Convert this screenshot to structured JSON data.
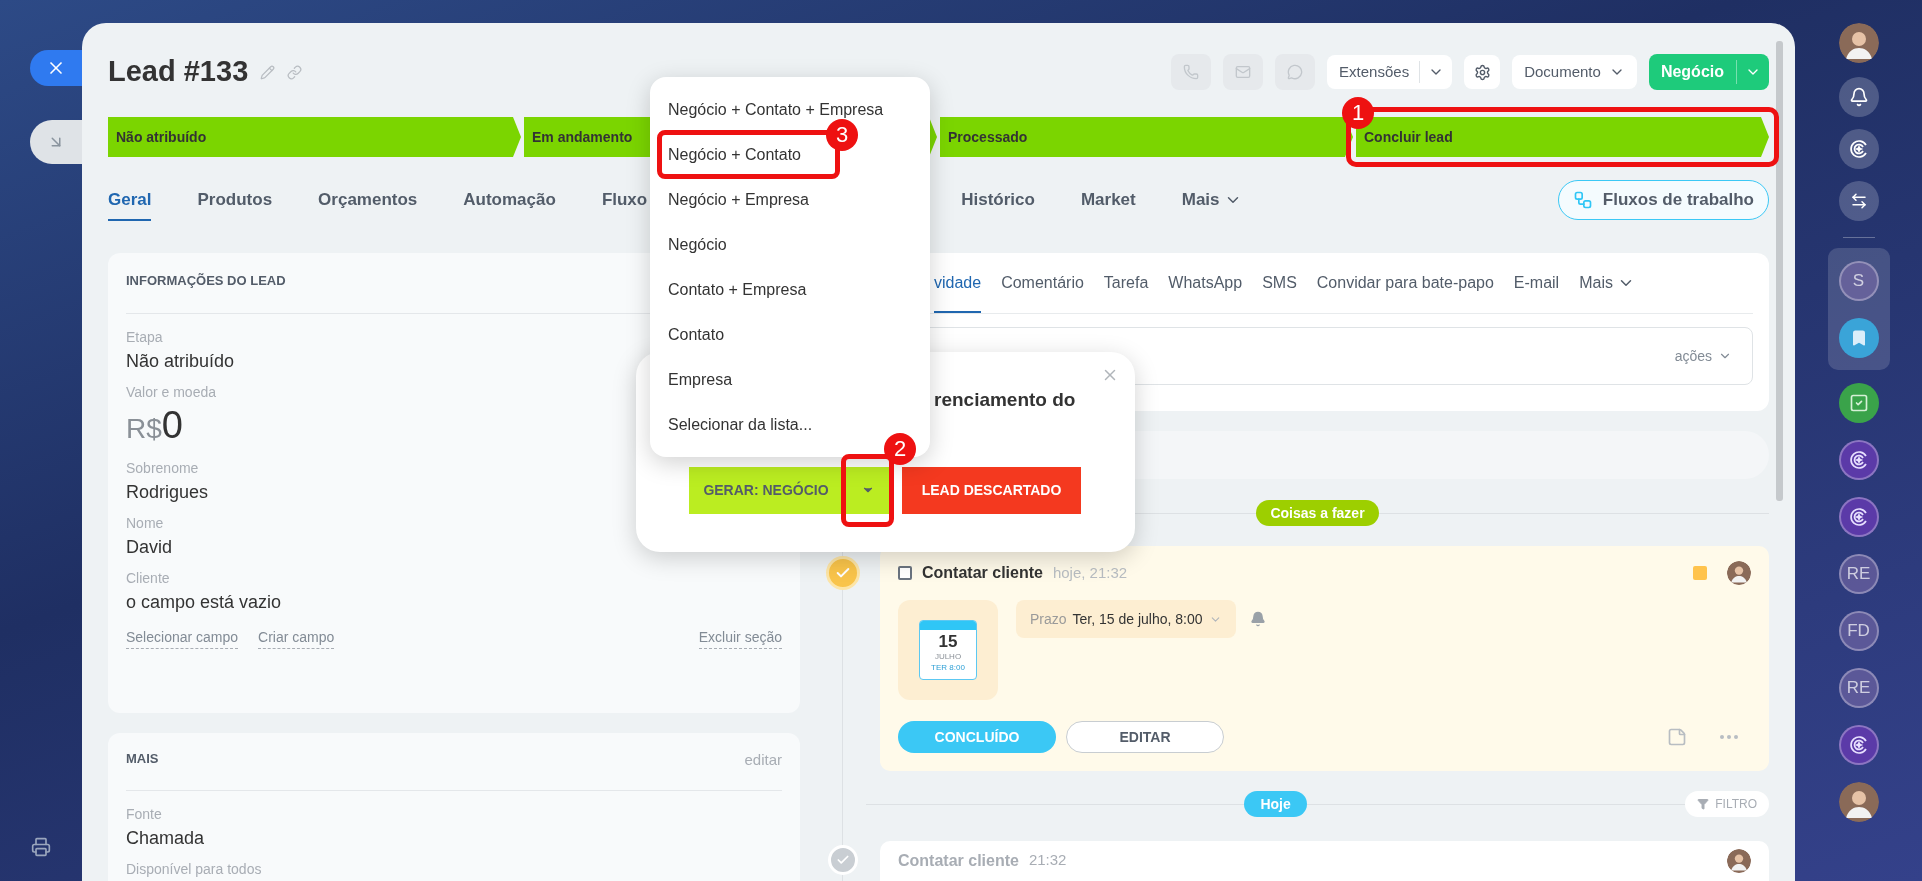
{
  "title": "Lead #133",
  "header": {
    "extensions": "Extensões",
    "document": "Documento",
    "primary": "Negócio"
  },
  "stages": [
    {
      "label": "Não atribuído"
    },
    {
      "label": "Em andamento"
    },
    {
      "label": "Processado"
    },
    {
      "label": "Concluir lead",
      "annotation": "1"
    }
  ],
  "tabs": [
    {
      "label": "Geral",
      "selected": true
    },
    {
      "label": "Produtos",
      "selected": false
    },
    {
      "label": "Orçamentos",
      "selected": false
    },
    {
      "label": "Automação",
      "selected": false
    },
    {
      "label": "Fluxo",
      "selected": false
    }
  ],
  "tabs_after_menu": [
    {
      "label": "Histórico",
      "selected": false
    },
    {
      "label": "Market",
      "selected": false
    },
    {
      "label": "Mais",
      "selected": false,
      "kind": "more"
    }
  ],
  "workflows_button": "Fluxos de trabalho",
  "lead_card": {
    "title": "INFORMAÇÕES DO LEAD",
    "fields": [
      {
        "kind": "text",
        "label": "Etapa",
        "value": "Não atribuído"
      },
      {
        "kind": "money",
        "label": "Valor e moeda",
        "currency": "R$",
        "value": "0"
      },
      {
        "kind": "text",
        "label": "Sobrenome",
        "value": "Rodrigues"
      },
      {
        "kind": "text",
        "label": "Nome",
        "value": "David"
      },
      {
        "kind": "text",
        "label": "Cliente",
        "value": "o campo está vazio"
      }
    ],
    "links": [
      "Selecionar campo",
      "Criar campo"
    ],
    "delete_link": "Excluir seção"
  },
  "more_card": {
    "title": "MAIS",
    "edit_link": "editar",
    "fields": [
      {
        "kind": "text",
        "label": "Fonte",
        "value": "Chamada"
      },
      {
        "kind": "text",
        "label": "Disponível para todos"
      }
    ]
  },
  "activity": {
    "tabs": [
      {
        "label": "vidade",
        "selected": true
      },
      {
        "label": "Comentário",
        "selected": false
      },
      {
        "label": "Tarefa",
        "selected": false
      },
      {
        "label": "WhatsApp",
        "selected": false
      },
      {
        "label": "SMS",
        "selected": false
      },
      {
        "label": "Convidar para bate-papo",
        "selected": false
      },
      {
        "label": "E-mail",
        "selected": false
      },
      {
        "label": "Mais",
        "selected": false,
        "kind": "more"
      }
    ],
    "actions": "ações"
  },
  "timeline": {
    "todo_label": "Coisas a fazer",
    "tasks": [
      {
        "checked": false,
        "title": "Contatar cliente",
        "time": "hoje, 21:32",
        "calendar": {
          "day": "15",
          "month": "JULHO",
          "weekday_time": "TER 8:00"
        },
        "deadline_label": "Prazo",
        "deadline": "Ter, 15 de julho, 8:00",
        "done_button": "CONCLUÍDO",
        "edit_button": "EDITAR"
      }
    ],
    "today_label": "Hoje",
    "filter": "FILTRO",
    "history": [
      {
        "title": "Contatar cliente",
        "time": "21:32"
      }
    ]
  },
  "popover": {
    "title": "renciamento do",
    "generate": "GERAR: NEGÓCIO",
    "generate_annotation": "2",
    "discard": "LEAD DESCARTADO"
  },
  "menu": [
    {
      "label": "Negócio + Contato + Empresa"
    },
    {
      "label": "Negócio + Contato",
      "annotation": "3"
    },
    {
      "label": "Negócio + Empresa"
    },
    {
      "label": "Negócio"
    },
    {
      "label": "Contato + Empresa"
    },
    {
      "label": "Contato"
    },
    {
      "label": "Empresa"
    },
    {
      "label": "Selecionar da lista..."
    }
  ],
  "sidebar": [
    {
      "kind": "avatar"
    },
    {
      "kind": "bell"
    },
    {
      "kind": "swirl"
    },
    {
      "kind": "chat"
    },
    {
      "kind": "divider"
    },
    {
      "kind": "pinned",
      "items": [
        {
          "kind": "letter",
          "text": "S"
        },
        {
          "kind": "bookmark"
        }
      ]
    },
    {
      "kind": "tasks"
    },
    {
      "kind": "swirl-purple"
    },
    {
      "kind": "swirl-purple"
    },
    {
      "kind": "letter",
      "text": "RE"
    },
    {
      "kind": "letter",
      "text": "FD"
    },
    {
      "kind": "letter",
      "text": "RE"
    },
    {
      "kind": "swirl-purple"
    },
    {
      "kind": "avatar"
    }
  ]
}
